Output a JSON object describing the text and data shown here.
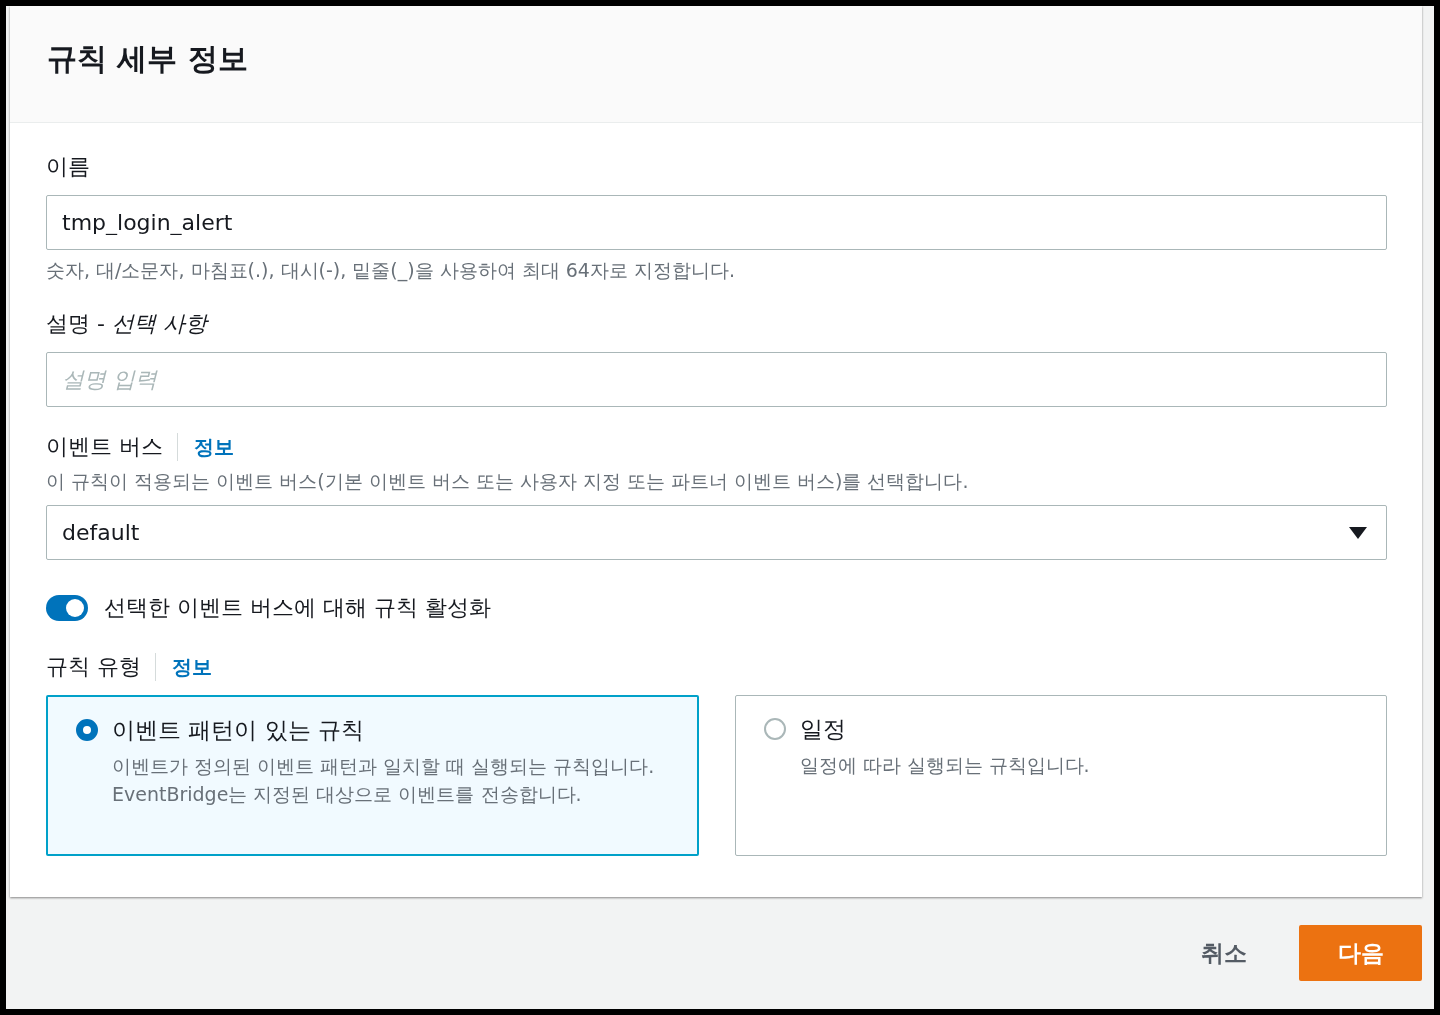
{
  "panel": {
    "title": "규칙 세부 정보"
  },
  "name_field": {
    "label": "이름",
    "value": "tmp_login_alert",
    "hint": "숫자, 대/소문자, 마침표(.), 대시(-), 밑줄(_)을 사용하여 최대 64자로 지정합니다."
  },
  "description_field": {
    "label": "설명 - *선택 사항*",
    "placeholder": "설명 입력"
  },
  "event_bus": {
    "label": "이벤트 버스",
    "info_link": "정보",
    "description": "이 규칙이 적용되는 이벤트 버스(기본 이벤트 버스 또는 사용자 지정 또는 파트너 이벤트 버스)를 선택합니다.",
    "value": "default"
  },
  "toggle": {
    "label": "선택한 이벤트 버스에 대해 규칙 활성화",
    "on": true
  },
  "rule_type": {
    "label": "규칙 유형",
    "info_link": "정보",
    "options": [
      {
        "title": "이벤트 패턴이 있는 규칙",
        "description": "이벤트가 정의된 이벤트 패턴과 일치할 때 실행되는 규칙입니다. EventBridge는 지정된 대상으로 이벤트를 전송합니다.",
        "selected": true
      },
      {
        "title": "일정",
        "description": "일정에 따라 실행되는 규칙입니다.",
        "selected": false
      }
    ]
  },
  "footer": {
    "cancel": "취소",
    "next": "다음"
  }
}
